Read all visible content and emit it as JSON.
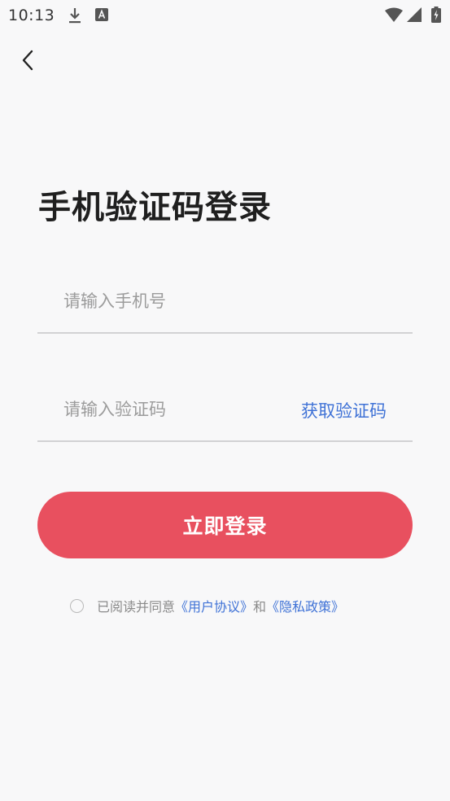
{
  "status_bar": {
    "time": "10:13",
    "icons": [
      "download-icon",
      "a-icon",
      "wifi-icon",
      "signal-icon",
      "battery-icon"
    ]
  },
  "nav": {
    "back_icon": "chevron-left-icon"
  },
  "title": "手机验证码登录",
  "phone_field": {
    "placeholder": "请输入手机号",
    "value": ""
  },
  "code_field": {
    "placeholder": "请输入验证码",
    "value": "",
    "get_code_label": "获取验证码"
  },
  "login_button": {
    "label": "立即登录"
  },
  "agreement": {
    "checked": false,
    "prefix": "已阅读并同意",
    "user_agreement": "《用户协议》",
    "conjunction": "和",
    "privacy_policy": "《隐私政策》"
  },
  "colors": {
    "background": "#f8f8f9",
    "accent_button": "#e8505f",
    "link": "#3f72d6",
    "placeholder": "#9c9c9c",
    "divider": "#d2d2d4"
  }
}
